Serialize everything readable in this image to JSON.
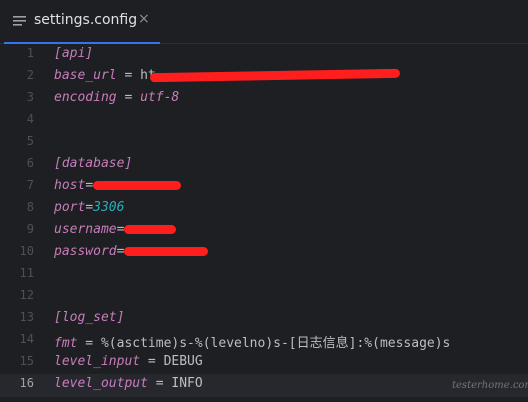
{
  "tab": {
    "title": "settings.config",
    "close_glyph": "×",
    "icon": "lines-file-icon"
  },
  "lines": [
    {
      "n": "1",
      "section": "[api]"
    },
    {
      "n": "2",
      "key": "base_url",
      "sep": " = ",
      "value": "ht",
      "redacted": true
    },
    {
      "n": "3",
      "key": "encoding",
      "sep": " = ",
      "value": "utf-8"
    },
    {
      "n": "4"
    },
    {
      "n": "5"
    },
    {
      "n": "6",
      "section": "[database]"
    },
    {
      "n": "7",
      "key": "host",
      "sep": "=",
      "redacted": true
    },
    {
      "n": "8",
      "key": "port",
      "sep": "=",
      "value": "3306"
    },
    {
      "n": "9",
      "key": "username",
      "sep": "=",
      "redacted": true
    },
    {
      "n": "10",
      "key": "password",
      "sep": "=",
      "redacted": true
    },
    {
      "n": "11"
    },
    {
      "n": "12"
    },
    {
      "n": "13",
      "section": "[log_set]"
    },
    {
      "n": "14",
      "key": "fmt",
      "sep": " = ",
      "value": "%(asctime)s-%(levelno)s-[日志信息]:%(message)s"
    },
    {
      "n": "15",
      "key": "level_input",
      "sep": " = ",
      "value": "DEBUG"
    },
    {
      "n": "16",
      "key": "level_output",
      "sep": " = ",
      "value": "INFO"
    }
  ],
  "current_line": "16",
  "watermark": "testerhome.com",
  "colors": {
    "accent": "#3574f0",
    "key": "#c77dbb",
    "number": "#2aacb8",
    "redaction": "#ff1e1e"
  }
}
